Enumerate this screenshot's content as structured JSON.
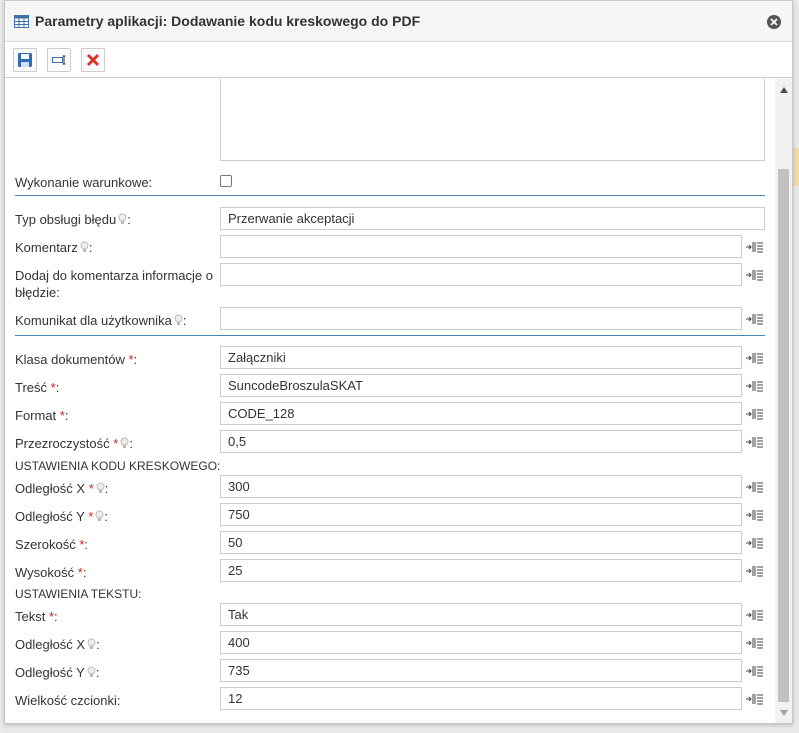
{
  "window": {
    "title": "Parametry aplikacji: Dodawanie kodu kreskowego do PDF"
  },
  "fields": {
    "conditional_label": "Wykonanie warunkowe:",
    "error_type_label": "Typ obsługi błędu",
    "error_type_value": "Przerwanie akceptacji",
    "comment_label": "Komentarz",
    "comment_value": "",
    "add_error_info_label_line1": "Dodaj do komentarza informacje o",
    "add_error_info_label_line2": "błędzie:",
    "add_error_info_value": "",
    "user_message_label": "Komunikat dla użytkownika",
    "user_message_value": "",
    "doc_class_label": "Klasa dokumentów",
    "doc_class_value": "Załączniki",
    "content_label": "Treść",
    "content_value": "SuncodeBroszulaSKAT",
    "format_label": "Format",
    "format_value": "CODE_128",
    "transparency_label": "Przezroczystość",
    "transparency_value": "0,5"
  },
  "barcode_settings": {
    "heading": "USTAWIENIA KODU KRESKOWEGO:",
    "x_label": "Odległość X",
    "x_value": "300",
    "y_label": "Odległość Y",
    "y_value": "750",
    "width_label": "Szerokość",
    "width_value": "50",
    "height_label": "Wysokość",
    "height_value": "25"
  },
  "text_settings": {
    "heading": "USTAWIENIA TEKSTU:",
    "text_label": "Tekst",
    "text_value": "Tak",
    "x_label": "Odległość X",
    "x_value": "400",
    "y_label": "Odległość Y",
    "y_value": "735",
    "font_size_label": "Wielkość czcionki:",
    "font_size_value": "12"
  },
  "symbols": {
    "required": "*",
    "colon": ":"
  },
  "colors": {
    "required": "#cc2222",
    "separator": "#4a86b8",
    "close_button": "#555555",
    "delete_icon": "#d9342b",
    "save_icon": "#2f6db5"
  }
}
